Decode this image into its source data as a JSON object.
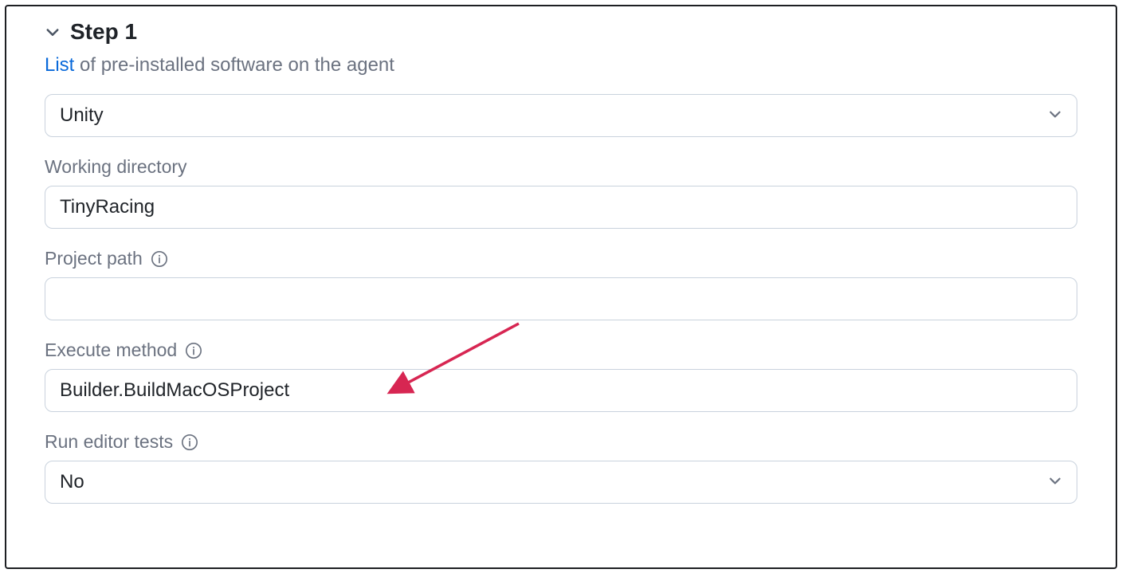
{
  "step": {
    "title": "Step 1",
    "sub_link": "List",
    "sub_rest": " of pre-installed software on the agent"
  },
  "fields": {
    "runner": {
      "selected": "Unity"
    },
    "working_directory": {
      "label": "Working directory",
      "value": "TinyRacing"
    },
    "project_path": {
      "label": "Project path",
      "value": ""
    },
    "execute_method": {
      "label": "Execute method",
      "value": "Builder.BuildMacOSProject"
    },
    "run_editor_tests": {
      "label": "Run editor tests",
      "selected": "No"
    }
  }
}
